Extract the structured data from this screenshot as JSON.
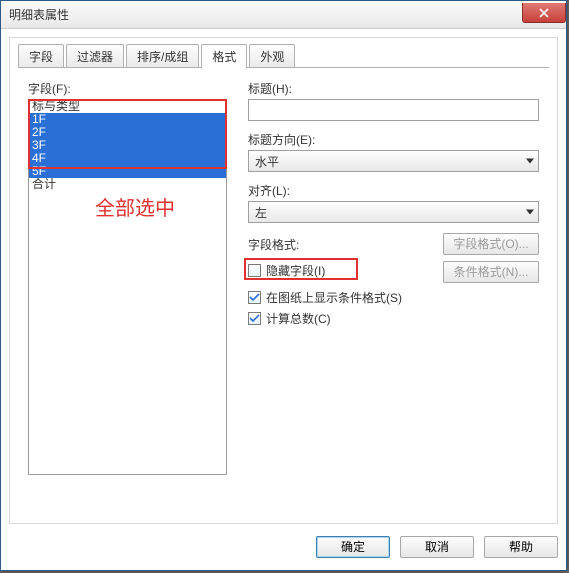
{
  "title": "明细表属性",
  "tabs": [
    "字段",
    "过滤器",
    "排序/成组",
    "格式",
    "外观"
  ],
  "active_tab_index": 3,
  "left": {
    "label": "字段(F):",
    "items": [
      "标与类型",
      "1F",
      "2F",
      "3F",
      "4F",
      "5F",
      "合计"
    ],
    "selected_indices": [
      1,
      2,
      3,
      4,
      5
    ],
    "annotation": "全部选中"
  },
  "right": {
    "title_label": "标题(H):",
    "title_value": "",
    "orient_label": "标题方向(E):",
    "orient_value": "水平",
    "align_label": "对齐(L):",
    "align_value": "左",
    "ff_label": "字段格式:",
    "ff_btn": "字段格式(O)...",
    "cond_btn": "条件格式(N)...",
    "hide_label": "隐藏字段(I)",
    "hide_checked": false,
    "cond_label": "在图纸上显示条件格式(S)",
    "cond_checked": true,
    "total_label": "计算总数(C)",
    "total_checked": true
  },
  "footer": {
    "ok": "确定",
    "cancel": "取消",
    "help": "帮助"
  }
}
